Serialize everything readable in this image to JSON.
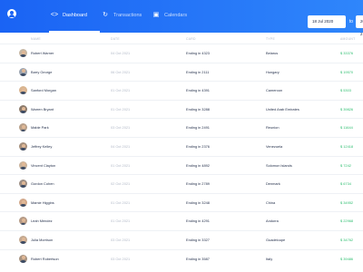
{
  "nav": {
    "tabs": [
      {
        "label": "Dashboard",
        "icon": "code-icon",
        "active": true
      },
      {
        "label": "Transactions",
        "icon": "refresh-icon",
        "active": false
      },
      {
        "label": "Calendars",
        "icon": "calendar-icon",
        "active": false
      }
    ],
    "date_from": "18 Jul 2020",
    "date_separator": "to",
    "date_to": "20 Jul 2"
  },
  "table": {
    "columns": [
      "NAME",
      "DATE",
      "CARD",
      "TYPE",
      "AMOUNT"
    ],
    "rows": [
      {
        "name": "Robert Warner",
        "date": "04 Oct 2021",
        "card": "Ending in 4323",
        "country": "Belarus",
        "amount": "$ 33376",
        "avatar_bg": "#c7b7a3"
      },
      {
        "name": "Barry George",
        "date": "06 Oct 2021",
        "card": "Ending in 2111",
        "country": "Hungary",
        "amount": "$ 19570",
        "avatar_bg": "#9aa3b0"
      },
      {
        "name": "Sanford Morgan",
        "date": "01 Oct 2021",
        "card": "Ending in 4391",
        "country": "Cameroon",
        "amount": "$ 5303",
        "avatar_bg": "#d8b48f"
      },
      {
        "name": "Warren Bryant",
        "date": "01 Oct 2021",
        "card": "Ending in 3288",
        "country": "United Arab Emirates",
        "amount": "$ 39826",
        "avatar_bg": "#8c7a6b"
      },
      {
        "name": "Mable Park",
        "date": "03 Oct 2021",
        "card": "Ending in 2491",
        "country": "Reunion",
        "amount": "$ 11644",
        "avatar_bg": "#b8a08a"
      },
      {
        "name": "Jeffrey Kelley",
        "date": "04 Oct 2021",
        "card": "Ending in 2376",
        "country": "Venezuela",
        "amount": "$ 12418",
        "avatar_bg": "#a58f7c"
      },
      {
        "name": "Vincent Clayton",
        "date": "01 Oct 2021",
        "card": "Ending in 4892",
        "country": "Solomon Islands",
        "amount": "$ 7242",
        "avatar_bg": "#c9b29a"
      },
      {
        "name": "Gordon Cohen",
        "date": "02 Oct 2021",
        "card": "Ending in 2789",
        "country": "Denmark",
        "amount": "$ 6734",
        "avatar_bg": "#9e8f85"
      },
      {
        "name": "Mamie Higgins",
        "date": "01 Oct 2021",
        "card": "Ending in 3248",
        "country": "China",
        "amount": "$ 34952",
        "avatar_bg": "#d2a88a"
      },
      {
        "name": "Leah Mendez",
        "date": "01 Oct 2021",
        "card": "Ending in 4291",
        "country": "Andorra",
        "amount": "$ 22968",
        "avatar_bg": "#b59a86"
      },
      {
        "name": "Julia Morrison",
        "date": "03 Oct 2021",
        "card": "Ending in 3327",
        "country": "Guadeloupe",
        "amount": "$ 34762",
        "avatar_bg": "#c4a991"
      },
      {
        "name": "Robert Robertson",
        "date": "03 Oct 2021",
        "card": "Ending in 3587",
        "country": "Italy",
        "amount": "$ 39486",
        "avatar_bg": "#a89482"
      }
    ]
  }
}
